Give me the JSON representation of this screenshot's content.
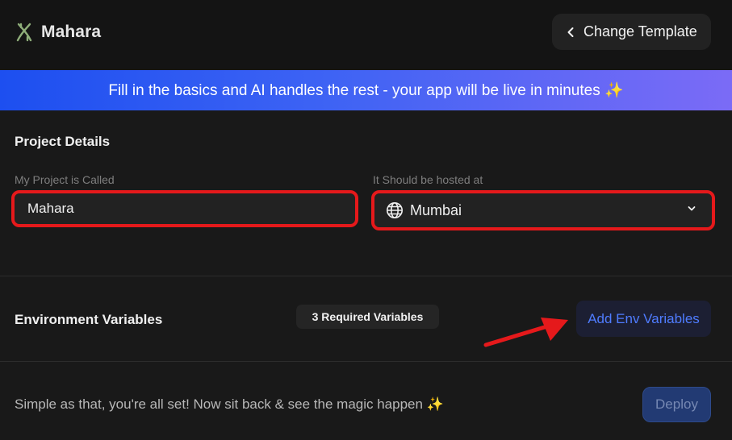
{
  "header": {
    "brand_name": "Mahara",
    "change_template_label": "Change Template"
  },
  "banner": {
    "text": "Fill in the basics and AI handles the rest - your app will be live in minutes ✨"
  },
  "project_details": {
    "title": "Project Details",
    "name_label": "My Project is Called",
    "name_value": "Mahara",
    "region_label": "It Should be hosted at",
    "region_value": "Mumbai"
  },
  "env": {
    "title": "Environment Variables",
    "required_badge": "3 Required Variables",
    "add_button_label": "Add Env Variables"
  },
  "footer": {
    "message": "Simple as that, you're all set! Now sit back & see the magic happen ✨",
    "deploy_label": "Deploy"
  },
  "colors": {
    "accent_blue": "#4f7cff",
    "highlight_red": "#e5191b",
    "brand_green": "#8fae7a"
  }
}
